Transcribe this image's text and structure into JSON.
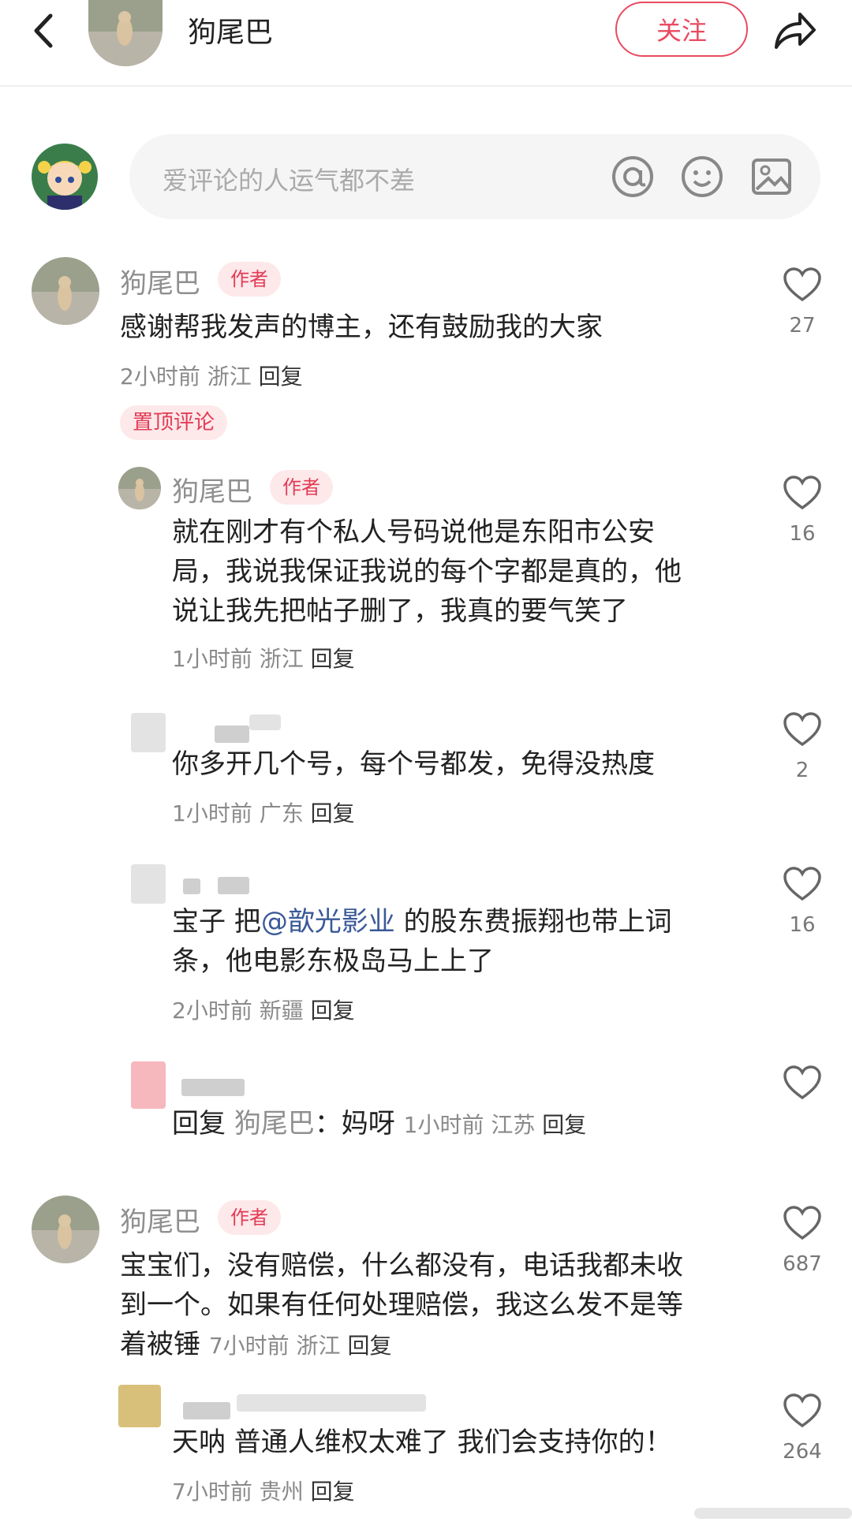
{
  "header": {
    "title": "狗尾巴",
    "follow_label": "关注"
  },
  "composer": {
    "placeholder": "爱评论的人运气都不差"
  },
  "author_badge": "作者",
  "pinned_label": "置顶评论",
  "reply_label": "回复",
  "comments": [
    {
      "name": "狗尾巴",
      "text_lines": [
        "感谢帮我发声的博主，还有鼓励我的大家"
      ],
      "time": "2小时前",
      "region": "浙江",
      "likes": "27"
    },
    {
      "name": "狗尾巴",
      "text_lines": [
        "就在刚才有个私人号码说他是东阳市公安",
        "局，我说我保证我说的每个字都是真的，他",
        "说让我先把帖子删了，我真的要气笑了"
      ],
      "time": "1小时前",
      "region": "浙江",
      "likes": "16"
    },
    {
      "name": "",
      "text_lines": [
        "你多开几个号，每个号都发，免得没热度"
      ],
      "time": "1小时前",
      "region": "广东",
      "likes": "2"
    },
    {
      "name": "",
      "text_pre": "宝子 把",
      "mention": "@歆光影业",
      "text_post": " 的股东费振翔也带上词",
      "text_line2": "条，他电影东极岛马上上了",
      "time": "2小时前",
      "region": "新疆",
      "likes": "16"
    },
    {
      "name": "",
      "reply_prefix": "回复",
      "reply_to": "狗尾巴",
      "reply_text": "：妈呀",
      "time": "1小时前",
      "region": "江苏",
      "likes": ""
    },
    {
      "name": "狗尾巴",
      "text_lines": [
        "宝宝们，没有赔偿，什么都没有，电话我都未收",
        "到一个。如果有任何处理赔偿，我这么发不是等"
      ],
      "text_last": "着被锤",
      "time": "7小时前",
      "region": "浙江",
      "likes": "687"
    },
    {
      "name": "",
      "text_lines": [
        "天呐 普通人维权太难了 我们会支持你的！"
      ],
      "time": "7小时前",
      "region": "贵州",
      "likes": "264"
    }
  ]
}
